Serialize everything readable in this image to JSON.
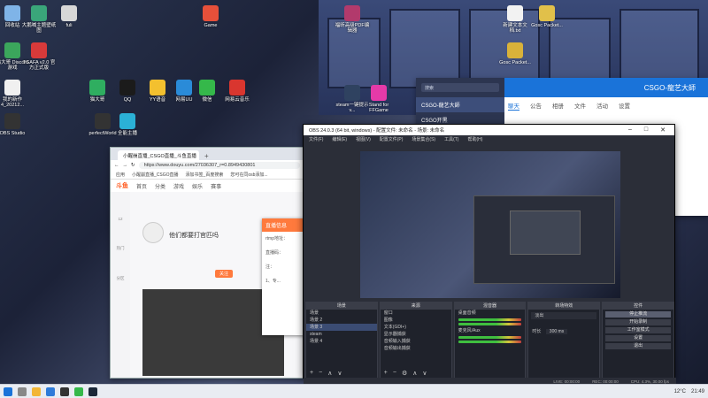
{
  "desktop_icons": [
    {
      "label": "回收站",
      "color": "#7fb4e8"
    },
    {
      "label": "大鹅喊主题壁纸图",
      "color": "#3aa67a"
    },
    {
      "label": "fuli",
      "color": "#d7d7d7"
    },
    {
      "label": "Game",
      "color": "#e6503a"
    },
    {
      "label": "福昕高级PDF编辑器",
      "color": "#b23a6c"
    },
    {
      "label": "新建文本文档.txt",
      "color": "#f2f2f2"
    },
    {
      "label": "Gosc Packet...",
      "color": "#e1c04a"
    },
    {
      "label": "猫大哥 Discord 游戏",
      "color": "#3ba65c"
    },
    {
      "label": "TGAFA v2.0 官方正式版",
      "color": "#d83a3a"
    },
    {
      "label": "Gosc Packet...",
      "color": "#d9b23a"
    },
    {
      "label": "我的新作 4_20212...",
      "color": "#f0f0f0"
    },
    {
      "label": "猫大哥",
      "color": "#2fae60"
    },
    {
      "label": "QQ",
      "color": "#1b1b1b"
    },
    {
      "label": "YY语音",
      "color": "#f3c02f"
    },
    {
      "label": "网易UU",
      "color": "#2a8bd8"
    },
    {
      "label": "微信",
      "color": "#35b84a"
    },
    {
      "label": "网易云音乐",
      "color": "#d9362f"
    },
    {
      "label": "steam一键提示 v...",
      "color": "#2f4260"
    },
    {
      "label": "Stand for FFGame",
      "color": "#e53aa8"
    },
    {
      "label": "OBS Studio",
      "color": "#333"
    },
    {
      "label": "perfectWorld",
      "color": "#333"
    },
    {
      "label": "全能主播",
      "color": "#2bb1d6"
    }
  ],
  "browser": {
    "tab_title": "小醒崩直播_CSGO直播_斗鱼直播",
    "url": "https://www.douyu.com/27036307_r=0.8949430801",
    "bookmarks": [
      "应用",
      "小醒崩直播_CSGO直播",
      "添加书签_百度搜索",
      "您可在同osb添加..."
    ],
    "nav": [
      "首页",
      "分类",
      "游戏",
      "娱乐",
      "赛事"
    ],
    "logo": "斗鱼",
    "room_title": "他们都要打官匹吗",
    "follow_label": "关注",
    "sidebar": [
      "12",
      "热门",
      "分区"
    ]
  },
  "popup": {
    "title": "直播信息",
    "lines": [
      "rtmp地址：",
      "直播码：",
      "注：",
      "1、专..."
    ]
  },
  "steam": {
    "title": "CSGO-龍艺大師",
    "search_placeholder": "搜索",
    "items": [
      "CSGO-龍艺大師",
      "CSGO开黑"
    ],
    "tabs": [
      "聊天",
      "公告",
      "相册",
      "文件",
      "活动",
      "设置"
    ]
  },
  "obs": {
    "title": "OBS 24.0.3 (64 bit, windows) - 配置文件: 未命名 - 场景: 未命名",
    "menu": [
      "文件(F)",
      "编辑(E)",
      "视图(V)",
      "配置文件(P)",
      "场景集合(S)",
      "工具(T)",
      "帮助(H)"
    ],
    "docks": {
      "scenes": {
        "title": "场景",
        "items": [
          "场景",
          "场景 2",
          "场景 3",
          "steam",
          "场景 4"
        ]
      },
      "sources": {
        "title": "来源",
        "items": [
          "窗口",
          "图像",
          "文本(GDI+)",
          "显示器捕获",
          "音频输入捕获",
          "音频输出捕获"
        ]
      },
      "mixer": {
        "title": "混音器",
        "items": [
          "桌面音频",
          "麦克风/Aux"
        ]
      },
      "transitions": {
        "title": "转场特效",
        "fade": "淡出",
        "duration_label": "时长",
        "duration": "300 ms"
      },
      "controls": {
        "title": "控件",
        "buttons": [
          "停止推流",
          "开始录制",
          "工作室模式",
          "设置",
          "退出"
        ]
      }
    },
    "status": [
      "LIVE: 00:00:00",
      "REC: 00:00:00",
      "CPU: 4.3%, 30.00 fps"
    ]
  },
  "taskbar": {
    "weather": "12°C",
    "time": "21:49"
  }
}
